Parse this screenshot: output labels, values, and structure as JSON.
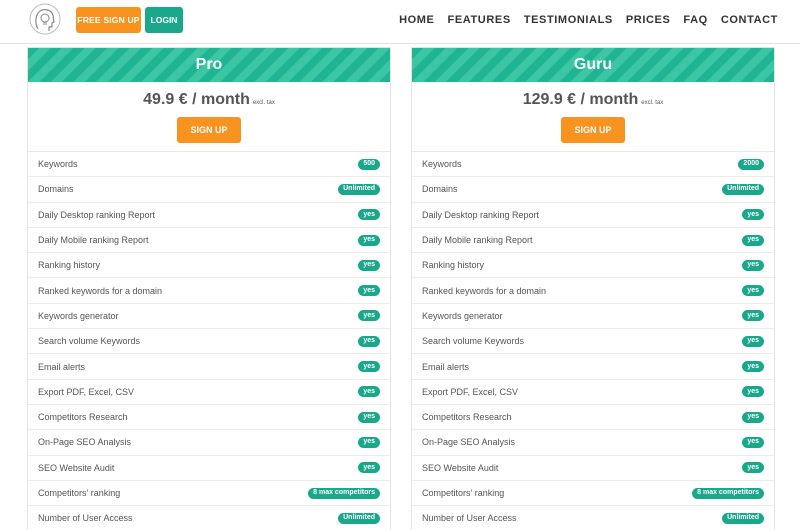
{
  "header": {
    "logo_icon": "lightbulb-head-icon",
    "signup_label": "FREE SIGN UP",
    "login_label": "LOGIN",
    "nav": [
      "HOME",
      "FEATURES",
      "TESTIMONIALS",
      "PRICES",
      "FAQ",
      "CONTACT"
    ]
  },
  "colors": {
    "accent_orange": "#f7931e",
    "accent_green": "#1aa88a"
  },
  "plans": [
    {
      "name": "Pro",
      "price": "49.9 € / month",
      "price_note": "excl. tax",
      "button": "SIGN UP",
      "features": [
        {
          "label": "Keywords",
          "value": "500"
        },
        {
          "label": "Domains",
          "value": "Unlimited"
        },
        {
          "label": "Daily Desktop ranking Report",
          "value": "yes"
        },
        {
          "label": "Daily Mobile ranking Report",
          "value": "yes"
        },
        {
          "label": "Ranking history",
          "value": "yes"
        },
        {
          "label": "Ranked keywords for a domain",
          "value": "yes"
        },
        {
          "label": "Keywords generator",
          "value": "yes"
        },
        {
          "label": "Search volume Keywords",
          "value": "yes"
        },
        {
          "label": "Email alerts",
          "value": "yes"
        },
        {
          "label": "Export PDF, Excel, CSV",
          "value": "yes"
        },
        {
          "label": "Competitors Research",
          "value": "yes"
        },
        {
          "label": "On-Page SEO Analysis",
          "value": "yes"
        },
        {
          "label": "SEO Website Audit",
          "value": "yes"
        },
        {
          "label": "Competitors' ranking",
          "value": "8 max competitors"
        },
        {
          "label": "Number of User Access",
          "value": "Unlimited"
        }
      ]
    },
    {
      "name": "Guru",
      "price": "129.9 € / month",
      "price_note": "excl. tax",
      "button": "SIGN UP",
      "features": [
        {
          "label": "Keywords",
          "value": "2000"
        },
        {
          "label": "Domains",
          "value": "Unlimited"
        },
        {
          "label": "Daily Desktop ranking Report",
          "value": "yes"
        },
        {
          "label": "Daily Mobile ranking Report",
          "value": "yes"
        },
        {
          "label": "Ranking history",
          "value": "yes"
        },
        {
          "label": "Ranked keywords for a domain",
          "value": "yes"
        },
        {
          "label": "Keywords generator",
          "value": "yes"
        },
        {
          "label": "Search volume Keywords",
          "value": "yes"
        },
        {
          "label": "Email alerts",
          "value": "yes"
        },
        {
          "label": "Export PDF, Excel, CSV",
          "value": "yes"
        },
        {
          "label": "Competitors Research",
          "value": "yes"
        },
        {
          "label": "On-Page SEO Analysis",
          "value": "yes"
        },
        {
          "label": "SEO Website Audit",
          "value": "yes"
        },
        {
          "label": "Competitors' ranking",
          "value": "8 max competitors"
        },
        {
          "label": "Number of User Access",
          "value": "Unlimited"
        }
      ]
    }
  ]
}
